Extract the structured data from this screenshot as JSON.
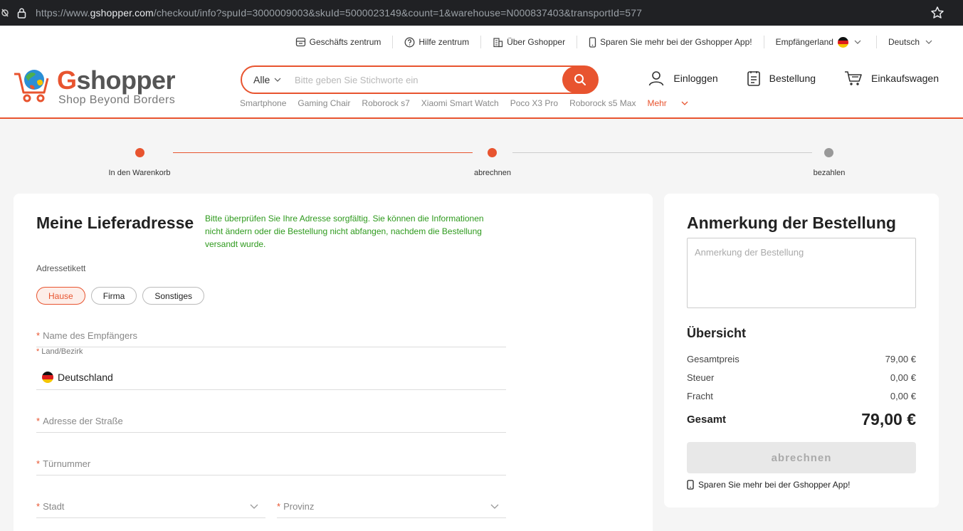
{
  "browser": {
    "url_prefix": "https://www.",
    "url_host": "gshopper.com",
    "url_path": "/checkout/info?spuId=3000009003&skuId=5000023149&count=1&warehouse=N000837403&transportId=577"
  },
  "topnav": {
    "business": "Geschäfts zentrum",
    "help": "Hilfe zentrum",
    "about": "Über Gshopper",
    "app": "Sparen Sie mehr bei der Gshopper App!",
    "country": "Empfängerland",
    "language": "Deutsch"
  },
  "logo": {
    "word_first": "G",
    "word_rest": "shopper",
    "tagline": "Shop Beyond Borders"
  },
  "search": {
    "category": "Alle",
    "placeholder": "Bitte geben Sie Stichworte ein"
  },
  "hotwords": [
    "Smartphone",
    "Gaming Chair",
    "Roborock s7",
    "Xiaomi Smart Watch",
    "Poco X3 Pro",
    "Roborock s5 Max"
  ],
  "hotwords_more": "Mehr",
  "header_actions": {
    "login": "Einloggen",
    "orders": "Bestellung",
    "cart": "Einkaufswagen"
  },
  "steps": [
    {
      "label": "In den Warenkorb",
      "state": "done"
    },
    {
      "label": "abrechnen",
      "state": "current"
    },
    {
      "label": "bezahlen",
      "state": "pending"
    }
  ],
  "address": {
    "title": "Meine Lieferadresse",
    "notice": "Bitte überprüfen Sie Ihre Adresse sorgfältig. Sie können die Informationen nicht ändern oder die Bestellung nicht abfangen, nachdem die Bestellung versandt wurde.",
    "tag_title": "Adressetikett",
    "tags": [
      "Hause",
      "Firma",
      "Sonstiges"
    ],
    "fields": {
      "recipient": "Name des Empfängers",
      "country_label": "Land/Bezirk",
      "country_value": "Deutschland",
      "street": "Adresse der Straße",
      "door": "Türnummer",
      "city": "Stadt",
      "province": "Provinz"
    },
    "required_mark": "*"
  },
  "order_note": {
    "title": "Anmerkung der Bestellung",
    "placeholder": "Anmerkung der Bestellung",
    "summary_title": "Übersicht",
    "lines": [
      {
        "label": "Gesamtpreis",
        "value": "79,00 €"
      },
      {
        "label": "Steuer",
        "value": "0,00 €"
      },
      {
        "label": "Fracht",
        "value": "0,00 €"
      }
    ],
    "total_label": "Gesamt",
    "total_value": "79,00 €",
    "checkout_label": "abrechnen",
    "app_promo": "Sparen Sie mehr bei der Gshopper App!"
  },
  "colors": {
    "accent": "#e8542f",
    "notice": "#2e9a1d",
    "pending": "#999999"
  }
}
